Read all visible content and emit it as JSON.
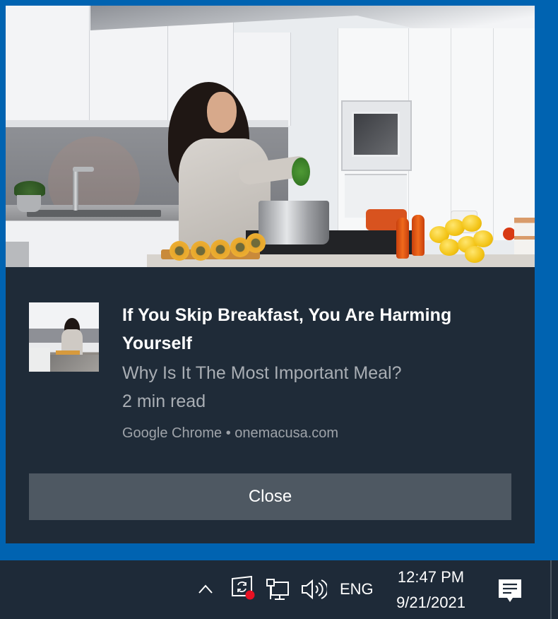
{
  "notification": {
    "hero_image": "kitchen-woman-cooking-photo",
    "thumbnail": "kitchen-woman-cooking-thumbnail",
    "title": "If You Skip Breakfast, You Are Harming Yourself",
    "body_line1": "Why Is It The Most Important Meal?",
    "body_line2": "2 min read",
    "attribution": "Google Chrome • onemacusa.com",
    "close_label": "Close"
  },
  "taskbar": {
    "tray_icons": [
      "chevron-up-icon",
      "sync-icon",
      "network-icon",
      "volume-icon"
    ],
    "language": "ENG",
    "time": "12:47 PM",
    "date": "9/21/2021",
    "action_center_icon": "action-center-icon"
  },
  "colors": {
    "desktop_background": "#0063b1",
    "toast_background": "#1f2b38",
    "close_button": "#4e5862",
    "taskbar_background": "#1e2a38",
    "badge_red": "#e81123"
  }
}
